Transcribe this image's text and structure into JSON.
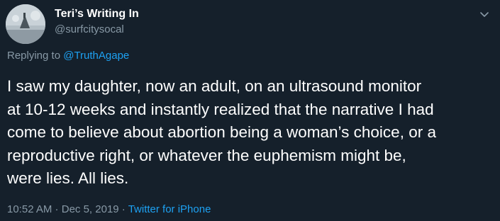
{
  "author": {
    "display_name": "Teri’s Writing In",
    "handle": "@surfcitysocal"
  },
  "reply": {
    "prefix": "Replying to ",
    "target": "@TruthAgape"
  },
  "tweet_lines": [
    "I saw my daughter, now an adult, on an ultrasound monitor",
    "at 10-12 weeks and instantly realized that the narrative I had",
    "come to believe about abortion being a woman’s choice, or a",
    "reproductive right, or whatever the euphemism might be,",
    "were lies. All lies."
  ],
  "meta": {
    "time": "10:52 AM",
    "sep1": " · ",
    "date": "Dec 5, 2019",
    "sep2": " · ",
    "source": "Twitter for iPhone"
  },
  "colors": {
    "background": "#15202b",
    "secondary_text": "#8899a6",
    "link": "#1da1f2"
  },
  "icons": {
    "menu": "chevron-down-icon"
  }
}
